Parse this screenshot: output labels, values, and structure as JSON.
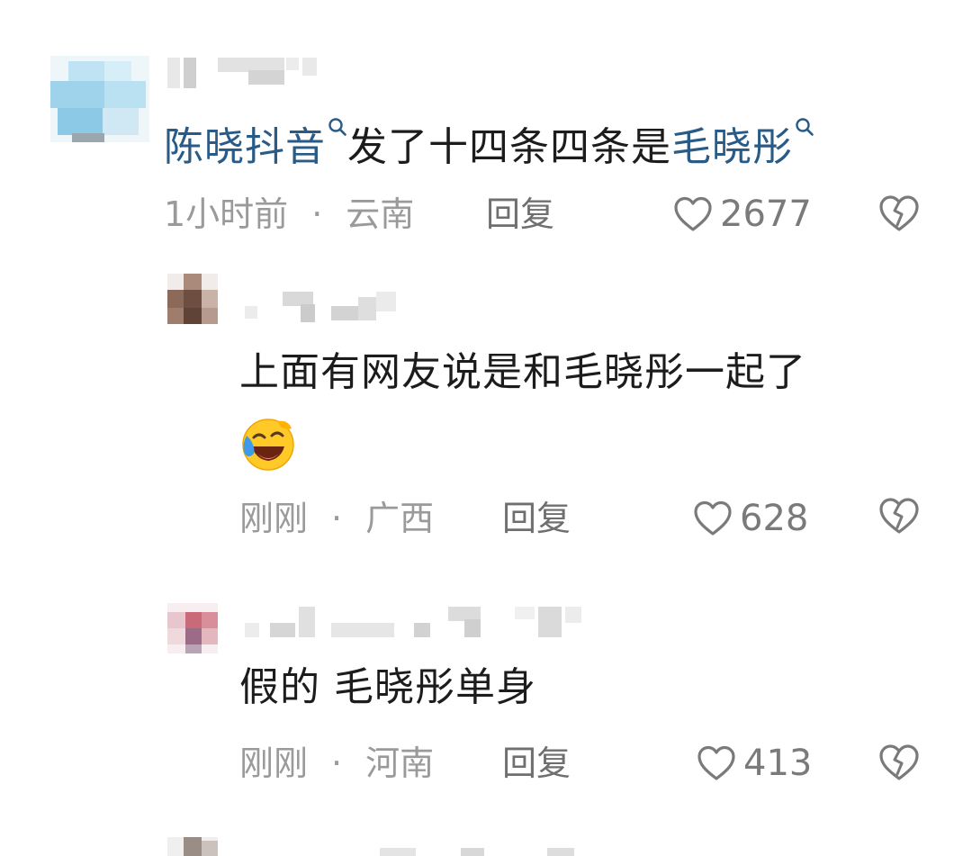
{
  "comments": [
    {
      "content_parts": [
        {
          "text": "陈晓抖音",
          "type": "link"
        },
        {
          "text": "发了十四条四条是",
          "type": "plain"
        },
        {
          "text": "毛晓彤",
          "type": "link"
        }
      ],
      "time": "1小时前",
      "location": "云南",
      "reply_label": "回复",
      "likes": "2677"
    },
    {
      "content": "上面有网友说是和毛晓彤一起了",
      "emoji": "laughing-crying-face",
      "time": "刚刚",
      "location": "广西",
      "reply_label": "回复",
      "likes": "628"
    },
    {
      "content": "假的 毛晓彤单身",
      "time": "刚刚",
      "location": "河南",
      "reply_label": "回复",
      "likes": "413"
    }
  ],
  "separator": "·",
  "icons": {
    "search": "search-icon",
    "like": "heart-outline-icon",
    "dislike": "broken-heart-icon"
  },
  "colors": {
    "link": "#2a5b86",
    "meta": "#9a9a9a",
    "text": "#1c1c1c"
  }
}
